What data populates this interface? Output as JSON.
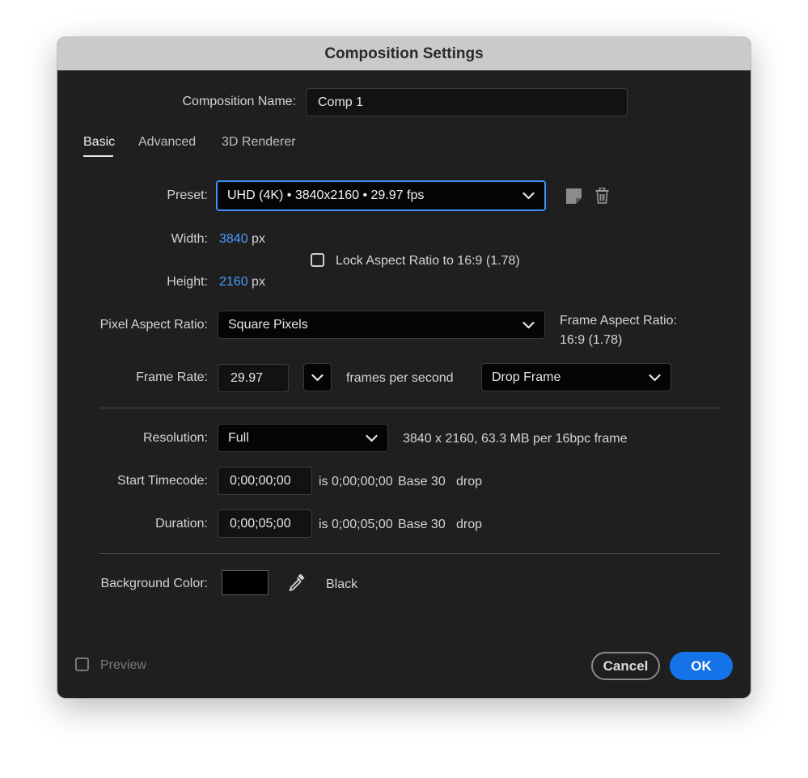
{
  "window": {
    "title": "Composition Settings"
  },
  "comp_name": {
    "label": "Composition Name:",
    "value": "Comp 1"
  },
  "tabs": [
    {
      "label": "Basic",
      "active": true
    },
    {
      "label": "Advanced",
      "active": false
    },
    {
      "label": "3D Renderer",
      "active": false
    }
  ],
  "preset": {
    "label": "Preset:",
    "value": "UHD (4K)  •  3840x2160 • 29.97 fps",
    "save_icon": "save-preset-icon",
    "delete_icon": "trash-icon"
  },
  "width": {
    "label": "Width:",
    "value": "3840",
    "unit": "px"
  },
  "height": {
    "label": "Height:",
    "value": "2160",
    "unit": "px"
  },
  "lock_aspect": {
    "label": "Lock Aspect Ratio to 16:9 (1.78)",
    "checked": false
  },
  "pixel_aspect": {
    "label": "Pixel Aspect Ratio:",
    "value": "Square Pixels"
  },
  "frame_aspect": {
    "label": "Frame Aspect Ratio:",
    "value": "16:9 (1.78)"
  },
  "frame_rate": {
    "label": "Frame Rate:",
    "value": "29.97",
    "unit": "frames per second",
    "mode": "Drop Frame"
  },
  "resolution": {
    "label": "Resolution:",
    "value": "Full",
    "info": "3840 x 2160, 63.3 MB per 16bpc frame"
  },
  "start_timecode": {
    "label": "Start Timecode:",
    "value": "0;00;00;00",
    "is": "is 0;00;00;00",
    "base": "Base 30",
    "drop": "drop"
  },
  "duration": {
    "label": "Duration:",
    "value": "0;00;05;00",
    "is": "is 0;00;05;00",
    "base": "Base 30",
    "drop": "drop"
  },
  "background": {
    "label": "Background Color:",
    "color": "#000000",
    "name": "Black",
    "eyedropper_icon": "eyedropper-icon"
  },
  "footer": {
    "preview_label": "Preview",
    "preview_checked": false,
    "cancel_label": "Cancel",
    "ok_label": "OK"
  },
  "colors": {
    "accent": "#1473e6",
    "link_value": "#4a9cff",
    "focus": "#3d8ff5",
    "dialog_bg": "#1f1f1f",
    "titlebar_bg": "#cacaca"
  }
}
